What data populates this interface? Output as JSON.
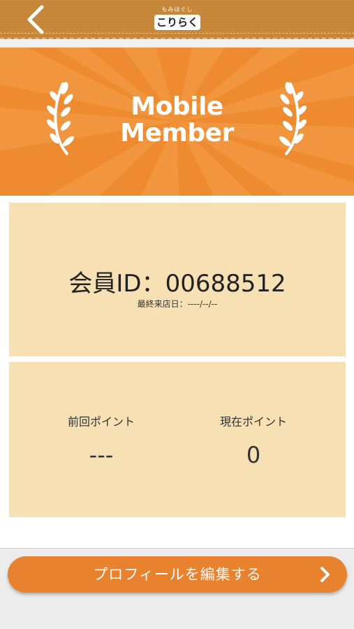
{
  "header": {
    "logo_sub": "もみほぐし",
    "logo_main": "こりらく"
  },
  "banner": {
    "title_line1": "Mobile",
    "title_line2": "Member"
  },
  "member": {
    "id_text": "会員ID：00688512",
    "last_visit_text": "最終来店日：----/--/--"
  },
  "points": {
    "previous_label": "前回ポイント",
    "previous_value": "---",
    "current_label": "現在ポイント",
    "current_value": "0"
  },
  "actions": {
    "edit_profile_label": "プロフィールを編集する"
  },
  "colors": {
    "accent": "#e8822e",
    "banner": "#ee8a30",
    "card": "#f7e0b3",
    "header": "#c98a3c"
  },
  "icons": {
    "back": "chevron-left-icon",
    "laurel": "laurel-icon",
    "forward": "chevron-right-icon"
  }
}
